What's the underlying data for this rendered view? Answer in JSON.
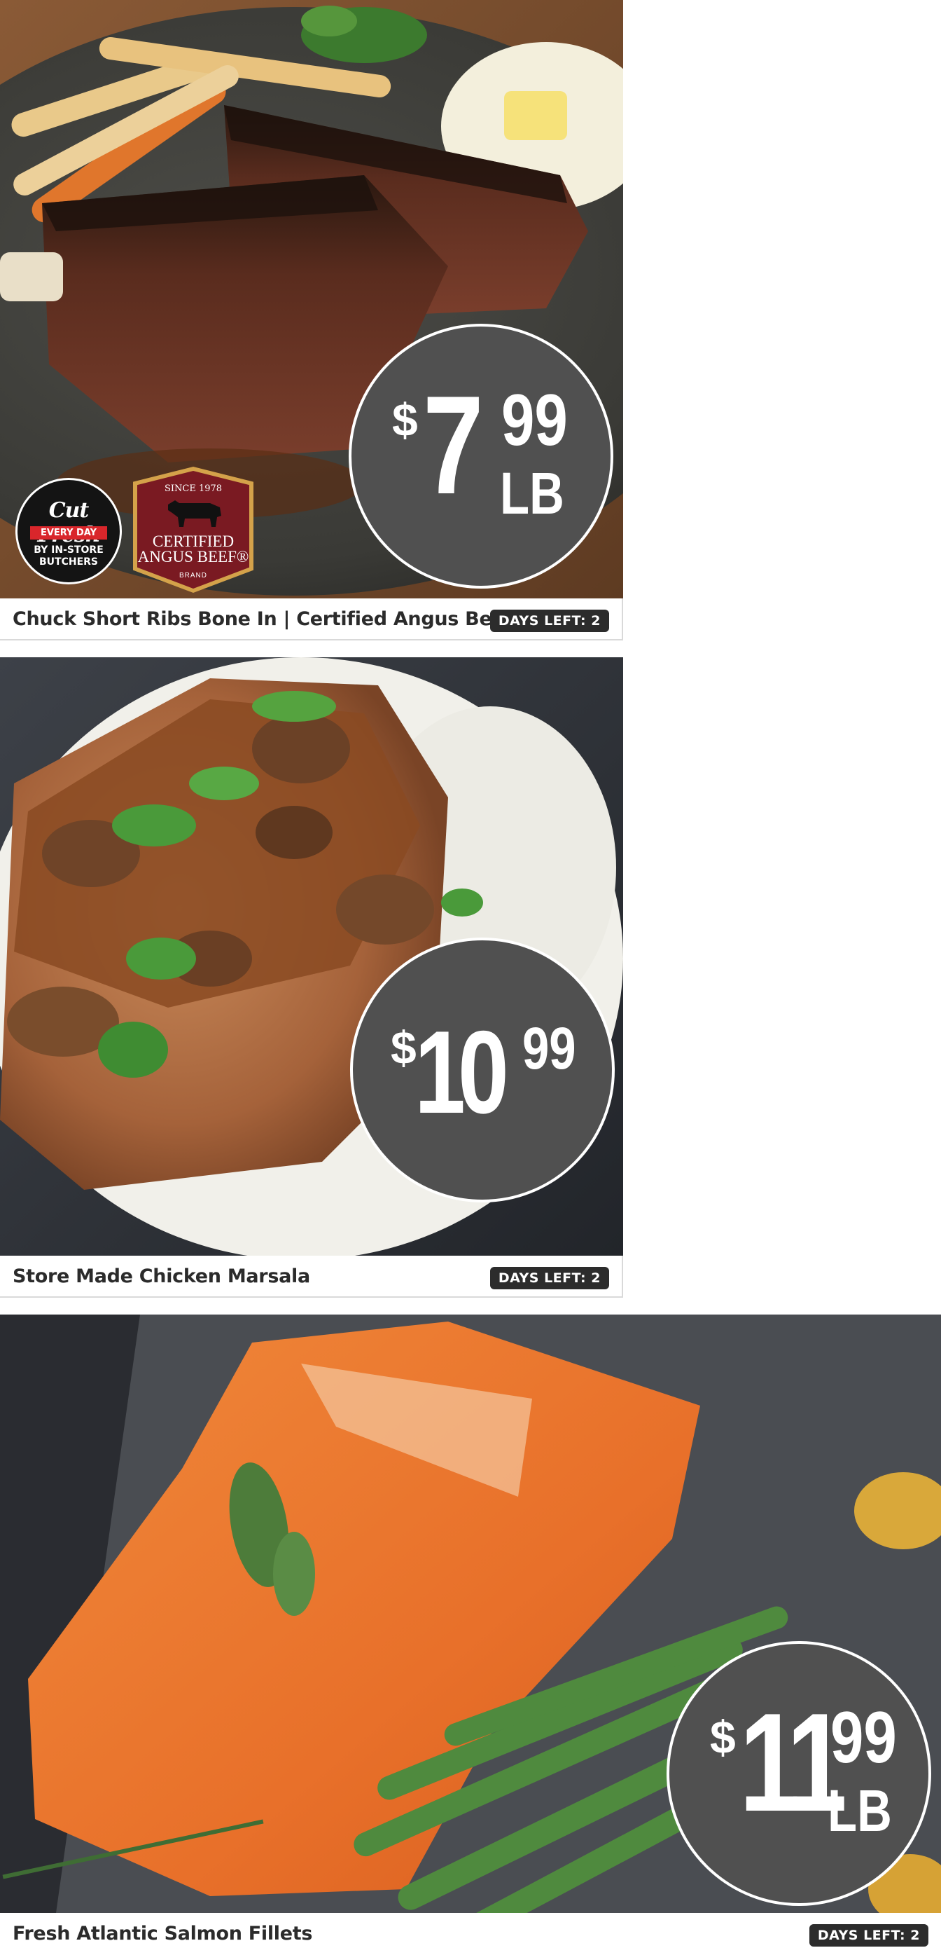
{
  "products": [
    {
      "title": "Chuck Short Ribs Bone In | Certified Angus Beef",
      "days_left": "DAYS LEFT: 2",
      "price": {
        "dollar": "$",
        "whole": "7",
        "cents": "99",
        "unit": "LB"
      },
      "image_desc_icon": "short-ribs-photo",
      "logos": {
        "cut_fresh": {
          "line1": "Cut Fresh",
          "line2": "EVERY DAY",
          "line3": "BY IN-STORE",
          "line4": "BUTCHERS"
        },
        "angus": {
          "since": "SINCE 1978",
          "line1": "CERTIFIED",
          "line2": "ANGUS BEEF®",
          "line3": "BRAND"
        }
      }
    },
    {
      "title": "Store Made Chicken Marsala",
      "days_left": "DAYS LEFT: 2",
      "price": {
        "dollar": "$",
        "whole": "10",
        "cents": "99",
        "unit": ""
      },
      "image_desc_icon": "chicken-marsala-photo"
    },
    {
      "title": "Fresh Atlantic Salmon Fillets",
      "days_left": "DAYS LEFT: 2",
      "price": {
        "dollar": "$",
        "whole": "11",
        "cents": "99",
        "unit": "LB"
      },
      "image_desc_icon": "salmon-photo"
    }
  ],
  "colors": {
    "price_circle": "#505050",
    "badge_bg": "#2c2c2c",
    "title_text": "#2b2b2b",
    "angus_red": "#7a1a22",
    "angus_gold": "#d4a24a",
    "cut_fresh_red": "#d9262b"
  }
}
